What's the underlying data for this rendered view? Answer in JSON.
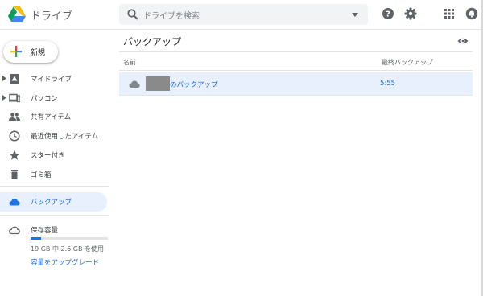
{
  "header": {
    "app_title": "ドライブ",
    "search_placeholder": "ドライブを検索"
  },
  "sidebar": {
    "new_label": "新規",
    "items": [
      {
        "label": "マイドライブ",
        "icon": "drive-folder-icon"
      },
      {
        "label": "パソコン",
        "icon": "computer-icon"
      },
      {
        "label": "共有アイテム",
        "icon": "people-icon"
      },
      {
        "label": "最近使用したアイテム",
        "icon": "clock-icon"
      },
      {
        "label": "スター付き",
        "icon": "star-icon"
      },
      {
        "label": "ゴミ箱",
        "icon": "trash-icon"
      },
      {
        "label": "バックアップ",
        "icon": "cloud-icon"
      }
    ],
    "storage": {
      "title": "保存容量",
      "usage": "19 GB 中 2.6 GB を使用",
      "upgrade": "容量をアップグレード",
      "used_fraction": 0.137
    }
  },
  "main": {
    "title": "バックアップ",
    "columns": {
      "name": "名前",
      "last_backup": "最終バックアップ"
    },
    "rows": [
      {
        "name": "のバックアップ",
        "last_backup": "5:55"
      }
    ]
  },
  "colors": {
    "accent": "#1a73e8",
    "active_bg": "#e8f0fe",
    "search_bg": "#f1f3f4"
  }
}
